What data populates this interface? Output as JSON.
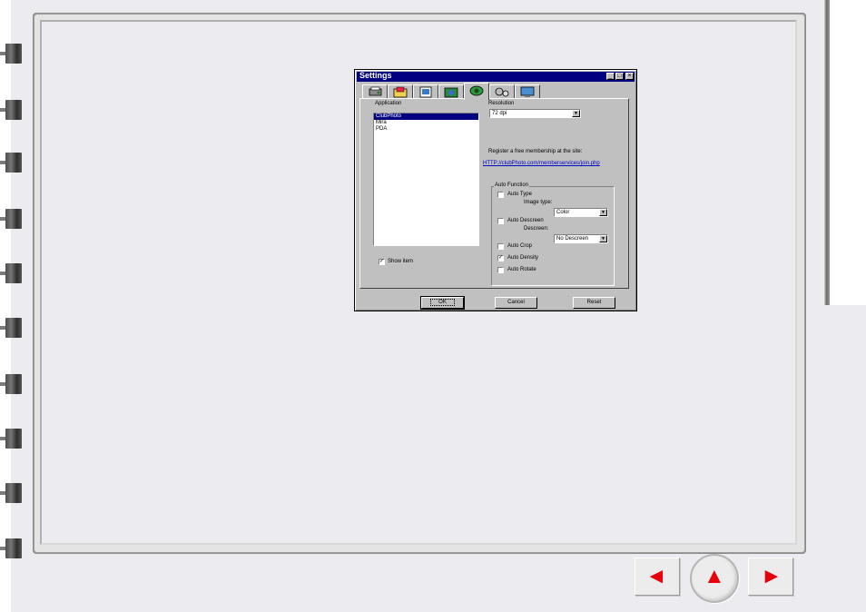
{
  "dialog": {
    "title": "Settings",
    "tabs": [
      "scanner-icon",
      "folder-icon",
      "image-icon",
      "globe-icon",
      "web-icon",
      "gears-icon",
      "display-icon"
    ],
    "application_label": "Application",
    "applications": [
      "ClubPhoto",
      "Mira",
      "PDA"
    ],
    "selected_application": "ClubPhoto",
    "show_item_label": "Show item",
    "resolution_label": "Resolution",
    "resolution_value": "72 dpi",
    "register_text": "Register a free membership at the site:",
    "register_link": "HTTP://clubPhoto.com/memberservices/join.php",
    "auto_function_label": "Auto Function",
    "auto_type_label": "Auto Type",
    "image_type_label": "Image type:",
    "image_type_value": "Color",
    "auto_descreen_label": "Auto Descreen",
    "descreen_label": "Descreen:",
    "descreen_value": "No Descreen",
    "auto_crop_label": "Auto Crop",
    "auto_density_label": "Auto Density",
    "auto_rotate_label": "Auto Rotate",
    "ok_label": "OK",
    "cancel_label": "Cancel",
    "reset_label": "Reset",
    "checkmark": "✓",
    "minimize": "_",
    "maximize": "□",
    "close": "×"
  },
  "navigation": {
    "prev": "◄",
    "up": "▲",
    "next": "►",
    "arrow_color": "#e8000b"
  }
}
